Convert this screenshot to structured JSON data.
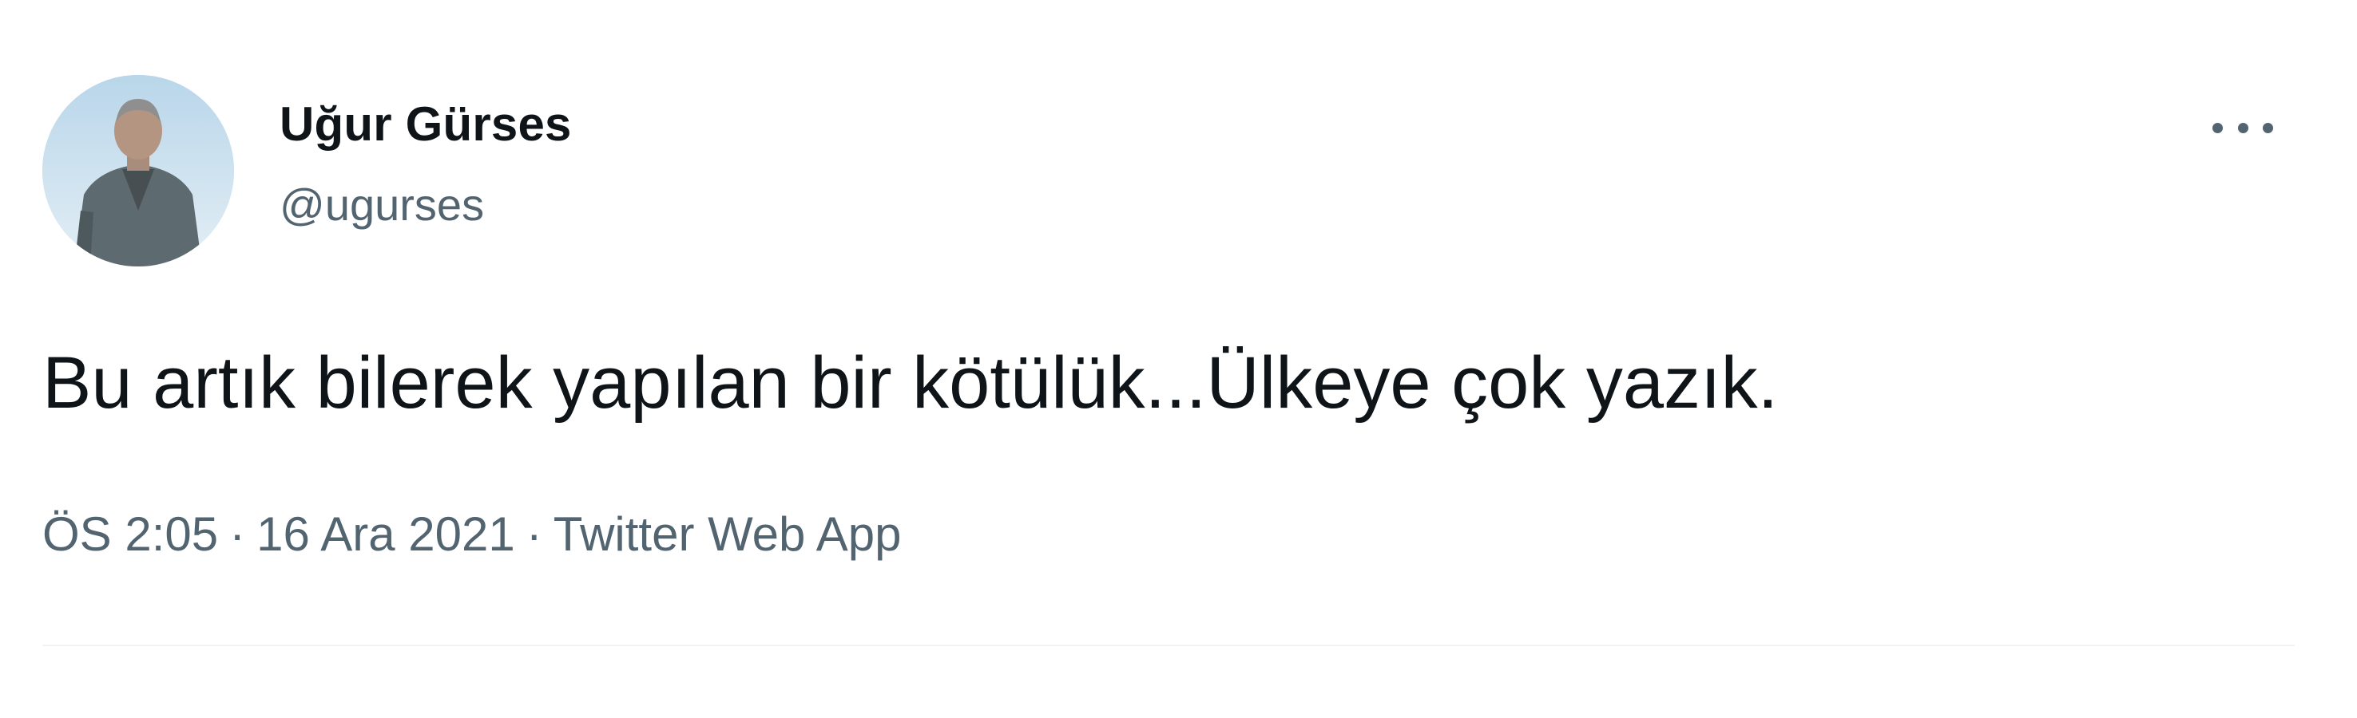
{
  "tweet": {
    "author": {
      "display_name": "Uğur Gürses",
      "handle": "@ugurses"
    },
    "text": "Bu artık bilerek yapılan bir kötülük...Ülkeye çok yazık.",
    "time": "ÖS 2:05",
    "date": "16 Ara 2021",
    "separator": "·",
    "source": "Twitter Web App",
    "more_icon": "more-horizontal-icon",
    "colors": {
      "primary_text": "#0f1419",
      "secondary_text": "#536471",
      "divider": "#eff3f4"
    }
  }
}
